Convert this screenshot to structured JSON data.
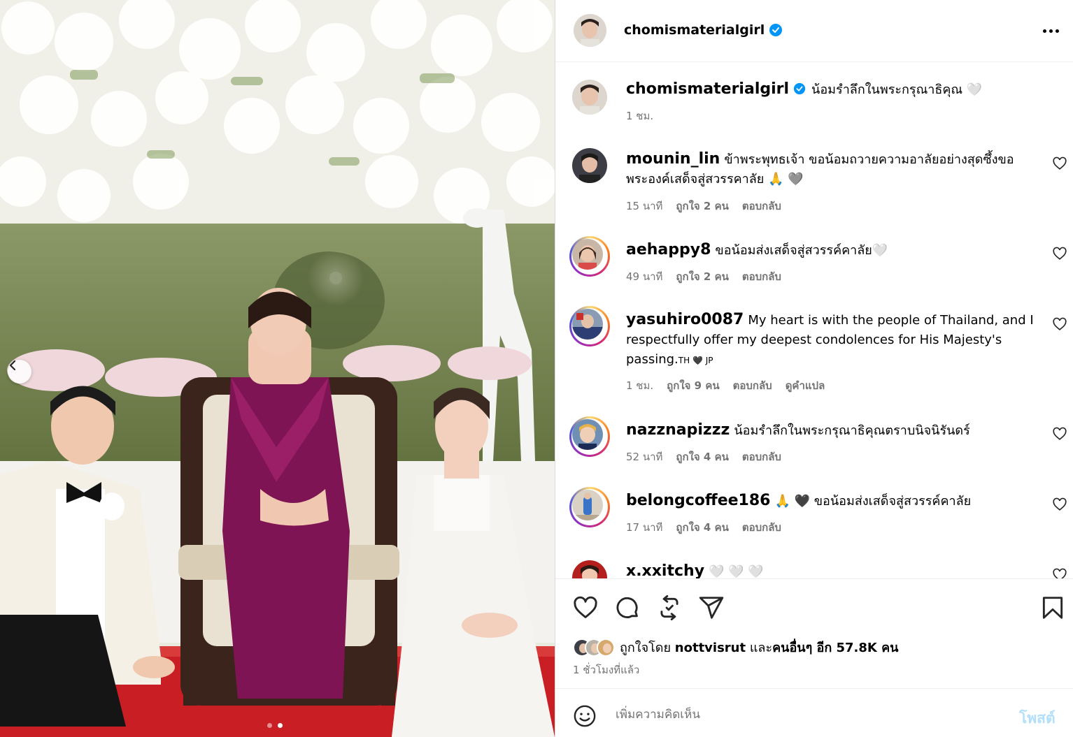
{
  "post": {
    "username": "chomismaterialgirl",
    "caption": "น้อมรำลึกในพระกรุณาธิคุณ 🤍",
    "caption_time": "1 ชม."
  },
  "comments": [
    {
      "username": "mounin_lin",
      "text": "ข้าพระพุทธเจ้า ขอน้อมถวายความอาลัยอย่างสุดซึ้งขอพระองค์เสด็จสู่สวรรคาลัย 🙏 🩶",
      "time": "15 นาที",
      "likes": "ถูกใจ 2 คน",
      "reply": "ตอบกลับ"
    },
    {
      "username": "aehappy8",
      "text": "ขอน้อมส่งเสด็จสู่สวรรค์คาลัย🤍",
      "time": "49 นาที",
      "likes": "ถูกใจ 2 คน",
      "reply": "ตอบกลับ"
    },
    {
      "username": "yasuhiro0087",
      "text_main": "My heart is with the people of Thailand, and I respectfully offer my deepest condolences for His Majesty's passing.",
      "text_flags": "TH 🖤 JP",
      "time": "1 ชม.",
      "likes": "ถูกใจ 9 คน",
      "reply": "ตอบกลับ",
      "translate": "ดูคำแปล"
    },
    {
      "username": "nazznapizzz",
      "text": "น้อมรำลึกในพระกรุณาธิคุณตราบนิจนิรันดร์",
      "time": "52 นาที",
      "likes": "ถูกใจ 4 คน",
      "reply": "ตอบกลับ"
    },
    {
      "username": "belongcoffee186",
      "text": "🙏 🖤 ขอน้อมส่งเสด็จสู่สวรรค์คาลัย",
      "time": "17 นาที",
      "likes": "ถูกใจ 4 คน",
      "reply": "ตอบกลับ"
    },
    {
      "username": "x.xxitchy",
      "text": "🤍 🤍 🤍"
    }
  ],
  "likes": {
    "prefix": "ถูกใจโดย",
    "user": "nottvisrut",
    "and": "และ",
    "others": "คนอื่นๆ อีก 57.8K คน",
    "time_ago": "1 ชั่วโมงที่แล้ว"
  },
  "add_comment": {
    "placeholder": "เพิ่มความคิดเห็น",
    "post_label": "โพสต์"
  },
  "carousel": {
    "current": 2,
    "total": 2
  },
  "colors": {
    "verified": "#0095f6",
    "post_disabled": "#b2dffc",
    "meta": "#737373"
  }
}
